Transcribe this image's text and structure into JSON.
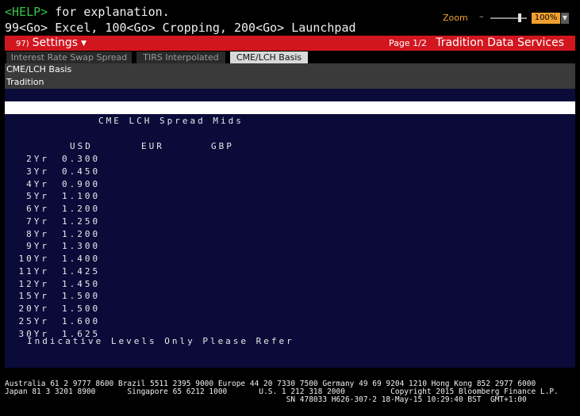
{
  "terminal": {
    "help_key": "<HELP>",
    "help_text": " for explanation.",
    "command_line": "99<Go> Excel, 100<Go> Cropping, 200<Go> Launchpad"
  },
  "titlebar": {
    "settings_number": "97)",
    "settings_label": "Settings",
    "page_indicator": "Page 1/2",
    "provider": "Tradition Data Services"
  },
  "tabs": [
    {
      "label": "Interest Rate Swap Spread"
    },
    {
      "label": "TIRS Interpolated"
    },
    {
      "label": "CME/LCH Basis",
      "active": true
    }
  ],
  "subheader": {
    "title": "CME/LCH Basis",
    "source": "Tradition",
    "zoom_label": "Zoom",
    "zoom_minus": "–",
    "zoom_value": "100%",
    "zoom_fraction": 0.8
  },
  "content": {
    "section_title": "CME LCH Spread Mids",
    "columns": [
      "USD",
      "EUR",
      "GBP"
    ],
    "rows": [
      {
        "tenor": "2Yr",
        "usd": "0.300"
      },
      {
        "tenor": "3Yr",
        "usd": "0.450"
      },
      {
        "tenor": "4Yr",
        "usd": "0.900"
      },
      {
        "tenor": "5Yr",
        "usd": "1.100"
      },
      {
        "tenor": "6Yr",
        "usd": "1.200"
      },
      {
        "tenor": "7Yr",
        "usd": "1.250"
      },
      {
        "tenor": "8Yr",
        "usd": "1.200"
      },
      {
        "tenor": "9Yr",
        "usd": "1.300"
      },
      {
        "tenor": "10Yr",
        "usd": "1.400"
      },
      {
        "tenor": "11Yr",
        "usd": "1.425"
      },
      {
        "tenor": "12Yr",
        "usd": "1.450"
      },
      {
        "tenor": "15Yr",
        "usd": "1.500"
      },
      {
        "tenor": "20Yr",
        "usd": "1.500"
      },
      {
        "tenor": "25Yr",
        "usd": "1.600"
      },
      {
        "tenor": "30Yr",
        "usd": "1.625"
      }
    ],
    "disclaimer": "Indicative Levels Only Please Refer"
  },
  "footer": {
    "line1": "Australia 61 2 9777 8600 Brazil 5511 2395 9000 Europe 44 20 7330 7500 Germany 49 69 9204 1210 Hong Kong 852 2977 6000",
    "line2": "Japan 81 3 3201 8900       Singapore 65 6212 1000       U.S. 1 212 318 2000          Copyright 2015 Bloomberg Finance L.P.",
    "line3": "                                                              SN 478033 H626-307-2 18-May-15 10:29:40 BST  GMT+1:00"
  },
  "colors": {
    "brand_red": "#d1161f",
    "panel_navy": "#0b0b3a",
    "accent_amber": "#f0a030",
    "help_green": "#39c24a"
  }
}
